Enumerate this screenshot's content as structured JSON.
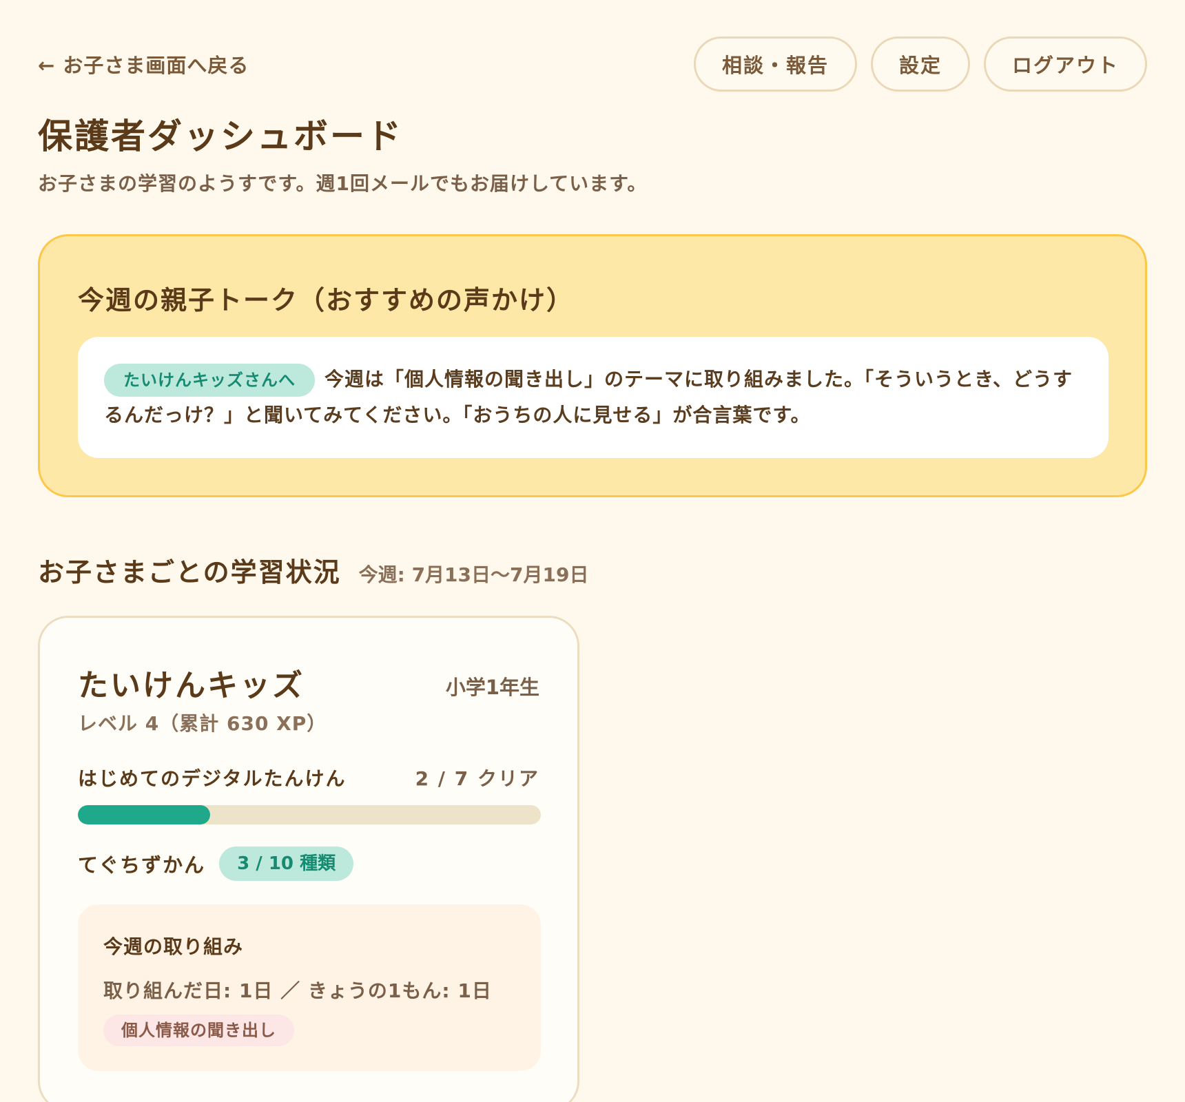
{
  "header": {
    "back_label": "← お子さま画面へ戻る",
    "buttons": [
      "相談・報告",
      "設定",
      "ログアウト"
    ]
  },
  "page": {
    "title": "保護者ダッシュボード",
    "subtitle": "お子さまの学習のようすです。週1回メールでもお届けしています。"
  },
  "talk": {
    "title": "今週の親子トーク（おすすめの声かけ）",
    "chip": "たいけんキッズさんへ",
    "message": "今週は「個人情報の聞き出し」のテーマに取り組みました。「そういうとき、どうするんだっけ？」と聞いてみてください。「おうちの人に見せる」が合言葉です。"
  },
  "section": {
    "title": "お子さまごとの学習状況",
    "week": "今週: 7月13日〜7月19日"
  },
  "child": {
    "name": "たいけんキッズ",
    "grade": "小学1年生",
    "level": "レベル 4（累計 630 XP）",
    "course_name": "はじめてのデジタルたんけん",
    "course_count": "2 / 7 クリア",
    "course_progress": 0.2857,
    "zukan_label": "てぐちずかん",
    "zukan_count": "3 / 10 種類",
    "weekly_title": "今週の取り組み",
    "weekly_stats": "取り組んだ日: 1日 ／ きょうの1もん: 1日",
    "theme": "個人情報の聞き出し"
  },
  "colors": {
    "background": "#fff8ec",
    "accent": "#1fa98a",
    "talk_card": "#fee8a8"
  }
}
